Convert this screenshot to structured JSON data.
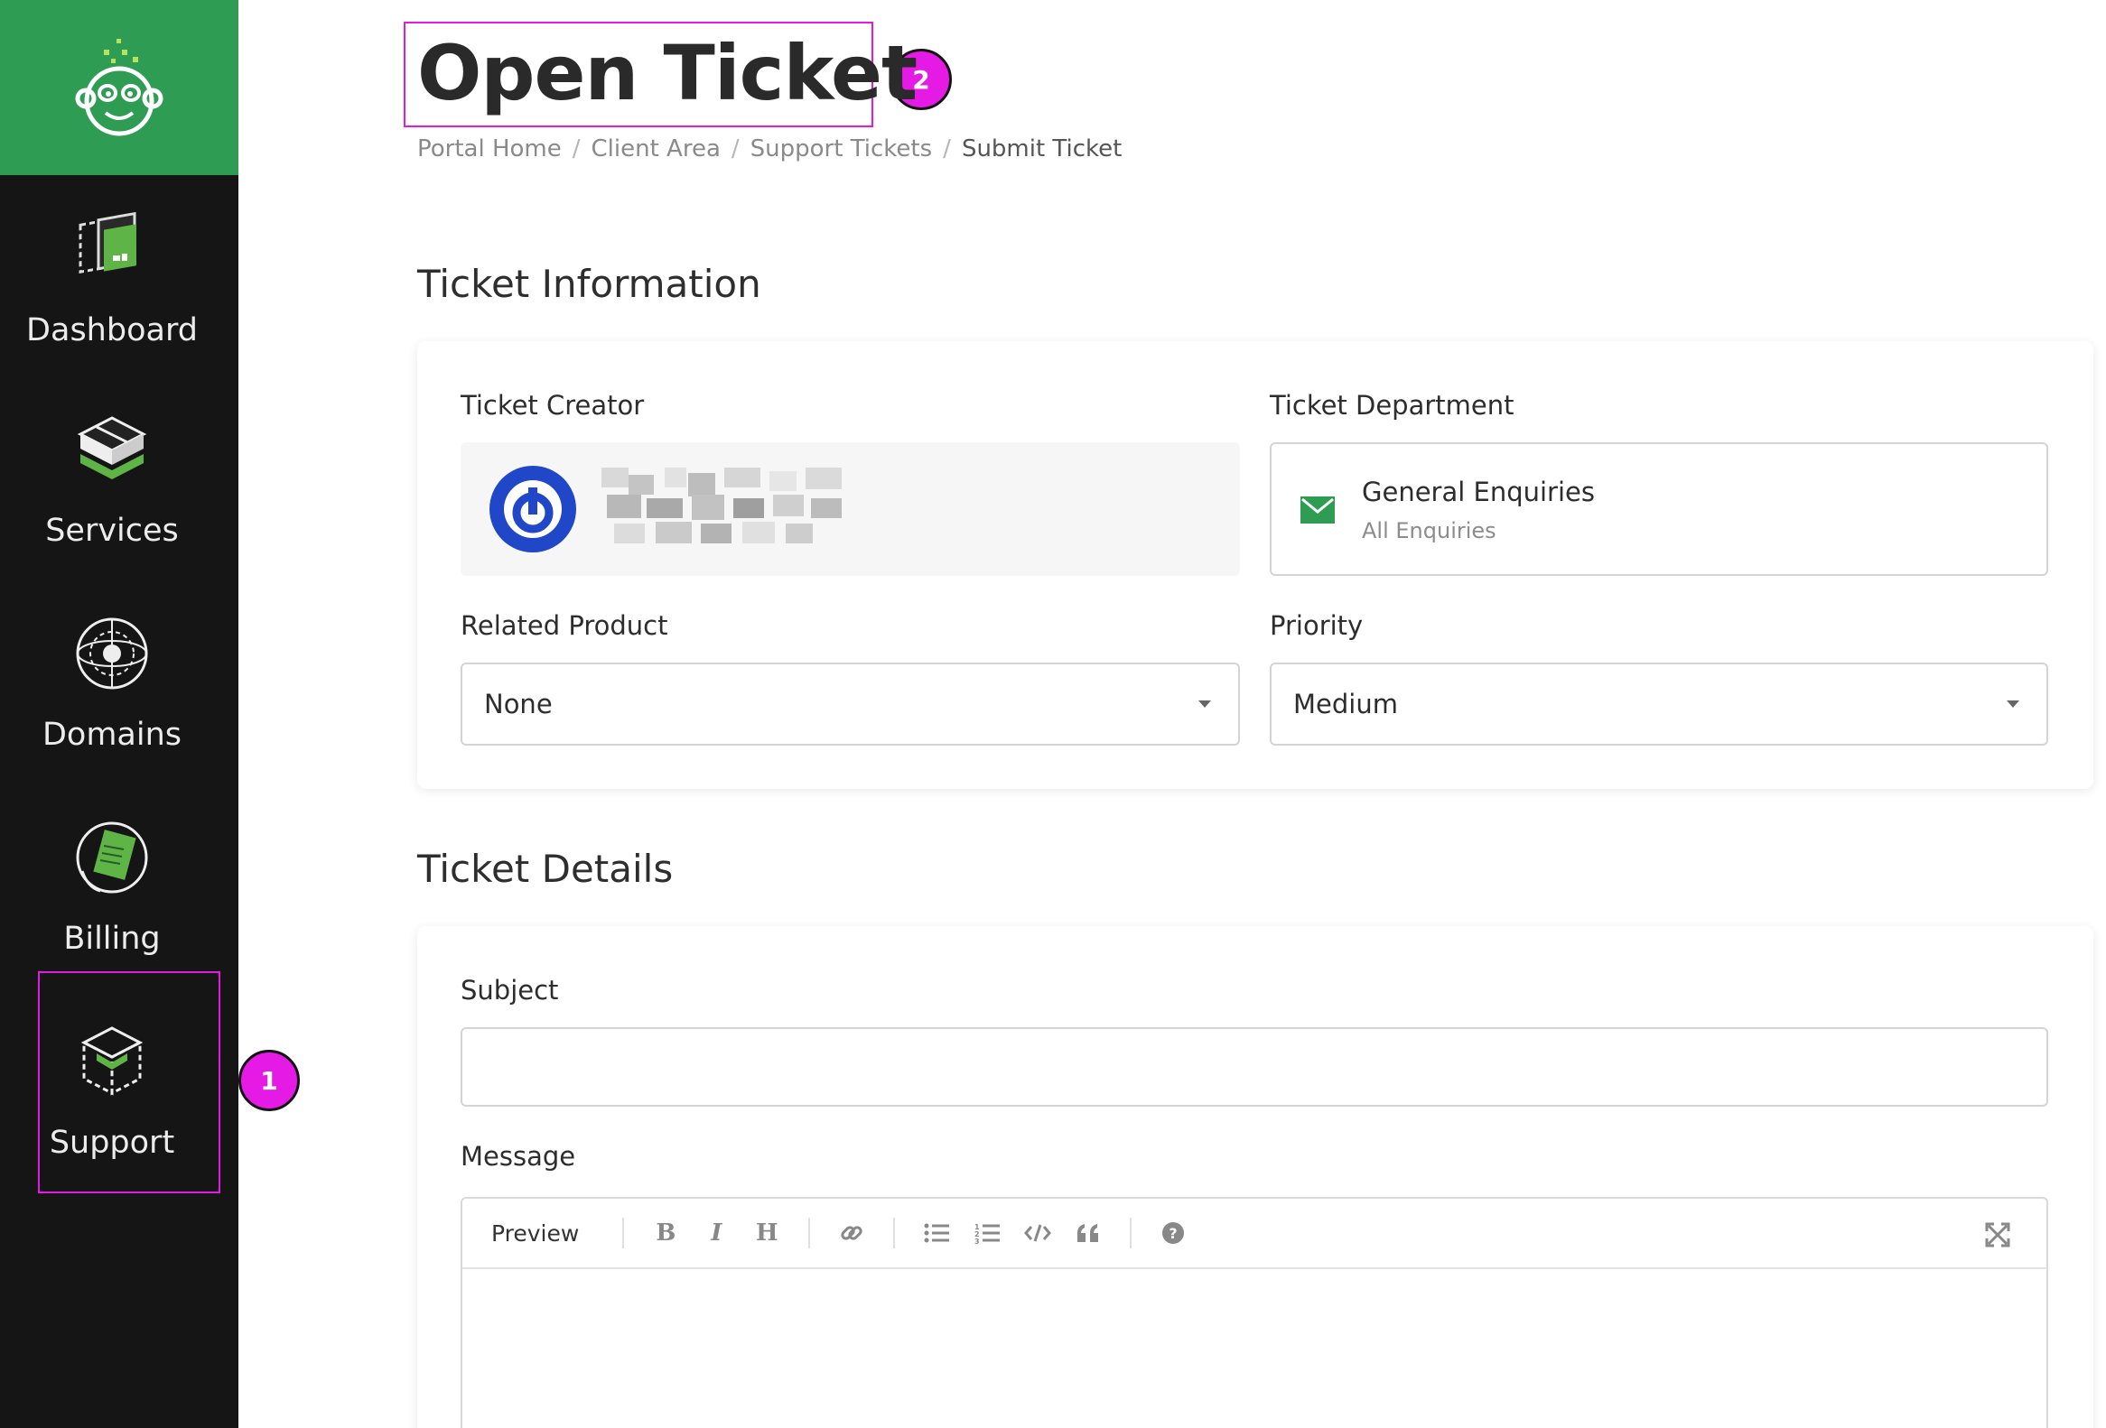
{
  "sidebar": {
    "items": [
      {
        "label": "Dashboard",
        "icon": "dashboard-icon"
      },
      {
        "label": "Services",
        "icon": "services-box-icon"
      },
      {
        "label": "Domains",
        "icon": "globe-icon"
      },
      {
        "label": "Billing",
        "icon": "billing-document-icon"
      },
      {
        "label": "Support",
        "icon": "support-box-icon"
      }
    ]
  },
  "annotations": {
    "badge_1": "1",
    "badge_2": "2"
  },
  "header": {
    "title": "Open Ticket",
    "breadcrumb": [
      "Portal Home",
      "Client Area",
      "Support Tickets",
      "Submit Ticket"
    ]
  },
  "ticket_information": {
    "section_title": "Ticket Information",
    "creator_label": "Ticket Creator",
    "department_label": "Ticket Department",
    "department_name": "General Enquiries",
    "department_sub": "All Enquiries",
    "related_product_label": "Related Product",
    "related_product_value": "None",
    "priority_label": "Priority",
    "priority_value": "Medium"
  },
  "ticket_details": {
    "section_title": "Ticket Details",
    "subject_label": "Subject",
    "subject_value": "",
    "message_label": "Message",
    "editor_preview": "Preview"
  },
  "colors": {
    "brand_green": "#2e9c52",
    "sidebar_bg": "#151515",
    "highlight": "#e31ae3",
    "avatar_blue": "#1f47c8"
  }
}
